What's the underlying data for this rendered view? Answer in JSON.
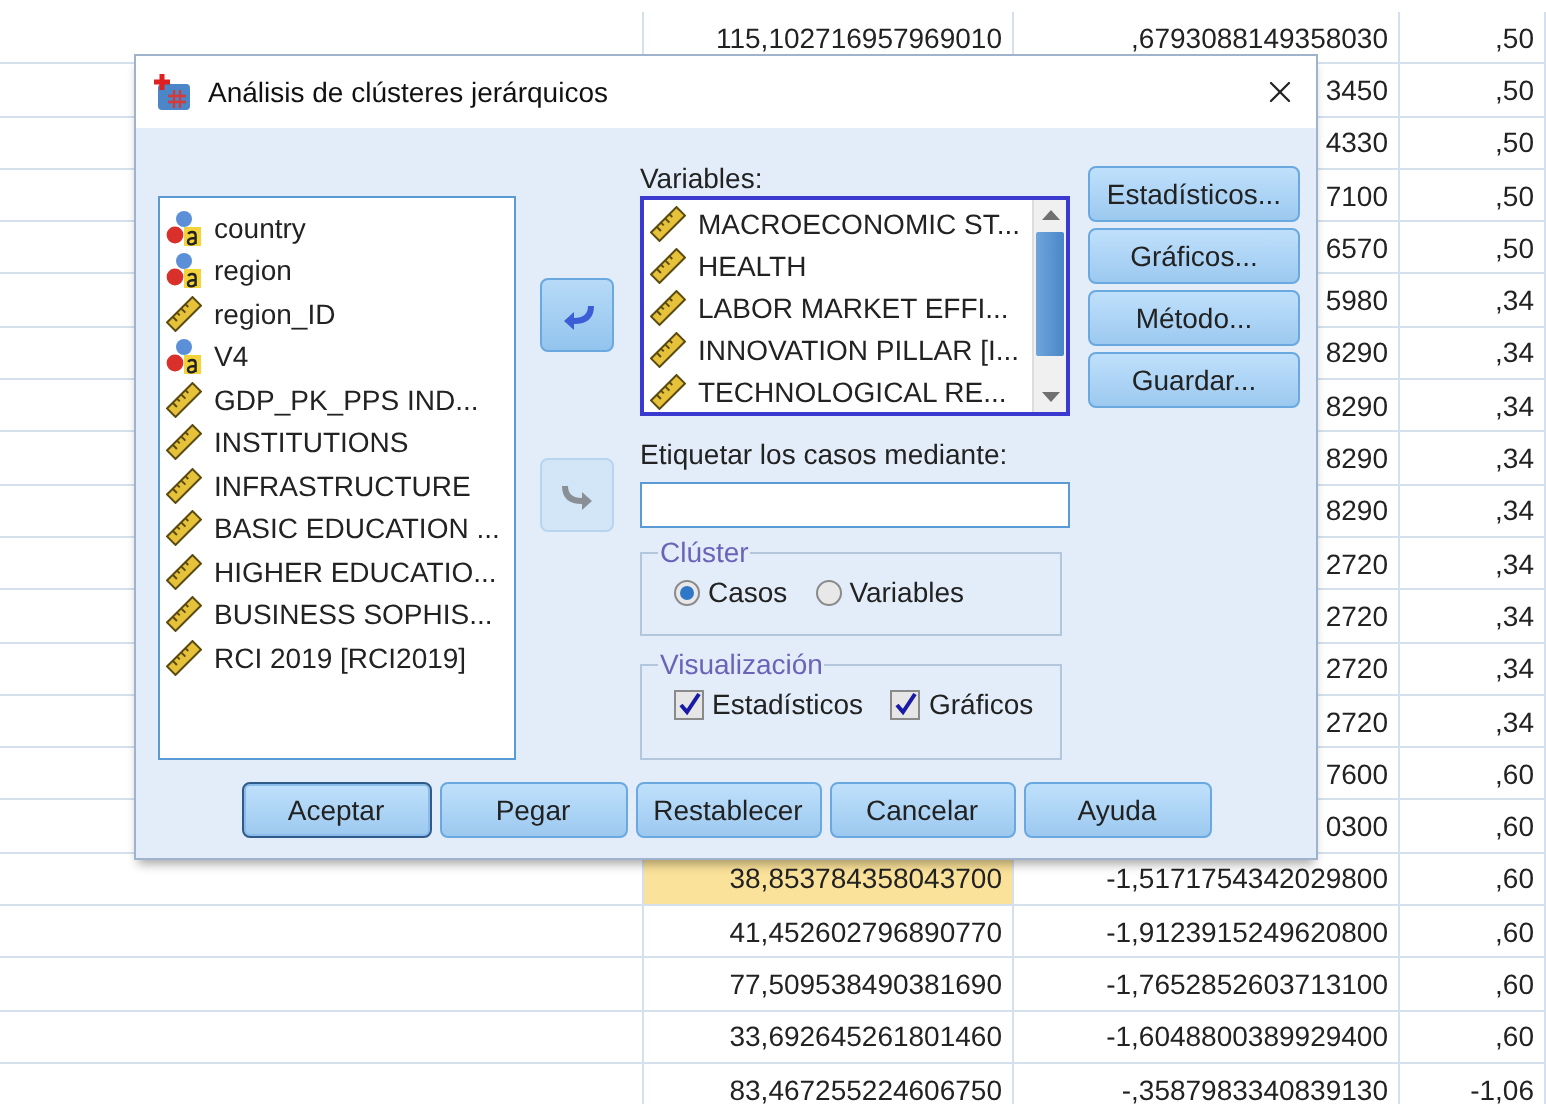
{
  "sheet": {
    "rows": [
      {
        "column_2": "115,102716957969010",
        "column_3": ",6793088149358030",
        "column_4": ",50",
        "selected": false
      },
      {
        "column_3": "3450",
        "column_4": ",50"
      },
      {
        "column_3": "4330",
        "column_4": ",50"
      },
      {
        "column_3": "7100",
        "column_4": ",50"
      },
      {
        "column_3": "6570",
        "column_4": ",50"
      },
      {
        "column_3": "5980",
        "column_4": ",34"
      },
      {
        "column_3": "8290",
        "column_4": ",34"
      },
      {
        "column_3": "8290",
        "column_4": ",34"
      },
      {
        "column_3": "8290",
        "column_4": ",34"
      },
      {
        "column_3": "8290",
        "column_4": ",34"
      },
      {
        "column_3": "2720",
        "column_4": ",34"
      },
      {
        "column_3": "2720",
        "column_4": ",34"
      },
      {
        "column_3": "2720",
        "column_4": ",34"
      },
      {
        "column_3": "2720",
        "column_4": ",34"
      },
      {
        "column_3": "7600",
        "column_4": ",60"
      },
      {
        "column_3": "0300",
        "column_4": ",60"
      },
      {
        "column_2": "38,853784358043700",
        "column_3": "-1,5171754342029800",
        "column_4": ",60",
        "selected": true
      },
      {
        "column_2": "41,452602796890770",
        "column_3": "-1,9123915249620800",
        "column_4": ",60",
        "selected": false
      },
      {
        "column_2": "77,509538490381690",
        "column_3": "-1,7652852603713100",
        "column_4": ",60",
        "selected": false
      },
      {
        "column_2": "33,692645261801460",
        "column_3": "-1,6048800389929400",
        "column_4": ",60",
        "selected": false
      },
      {
        "column_2": "83,467255224606750",
        "column_3": "-,3587983340839130",
        "column_4": "-1,06",
        "selected": false
      }
    ]
  },
  "dialog": {
    "title": "Análisis de clústeres jerárquicos",
    "source_list": [
      {
        "label": "country",
        "kind": "nominal"
      },
      {
        "label": "region",
        "kind": "nominal"
      },
      {
        "label": "region_ID",
        "kind": "scale"
      },
      {
        "label": "V4",
        "kind": "nominal"
      },
      {
        "label": "GDP_PK_PPS IND...",
        "kind": "scale"
      },
      {
        "label": "INSTITUTIONS",
        "kind": "scale"
      },
      {
        "label": "INFRASTRUCTURE",
        "kind": "scale"
      },
      {
        "label": "BASIC EDUCATION ...",
        "kind": "scale"
      },
      {
        "label": "HIGHER EDUCATIO...",
        "kind": "scale"
      },
      {
        "label": "BUSINESS SOPHIS...",
        "kind": "scale"
      },
      {
        "label": "RCI 2019 [RCI2019]",
        "kind": "scale"
      }
    ],
    "move_buttons": [
      {
        "kind": "left",
        "disabled": false
      },
      {
        "kind": "right",
        "disabled": true
      }
    ],
    "variables": {
      "label": "Variables:",
      "items": [
        {
          "label": "MACROECONOMIC ST...",
          "kind": "scale"
        },
        {
          "label": "HEALTH",
          "kind": "scale"
        },
        {
          "label": "LABOR MARKET EFFI...",
          "kind": "scale"
        },
        {
          "label": "INNOVATION PILLAR [I...",
          "kind": "scale"
        },
        {
          "label": "TECHNOLOGICAL RE...",
          "kind": "scale"
        }
      ]
    },
    "label_cases": {
      "label": "Etiquetar los casos mediante:"
    },
    "cluster": {
      "title": "Clúster",
      "options": [
        {
          "label": "Casos",
          "selected": true
        },
        {
          "label": "Variables",
          "selected": false
        }
      ]
    },
    "display": {
      "title": "Visualización",
      "options": [
        {
          "label": "Estadísticos",
          "checked": true
        },
        {
          "label": "Gráficos",
          "checked": true
        }
      ]
    },
    "side_buttons": [
      "Estadísticos...",
      "Gráficos...",
      "Método...",
      "Guardar..."
    ],
    "buttons": [
      {
        "label": "Aceptar",
        "default": true
      },
      {
        "label": "Pegar",
        "default": false
      },
      {
        "label": "Restablecer",
        "default": false
      },
      {
        "label": "Cancelar",
        "default": false
      },
      {
        "label": "Ayuda",
        "default": false
      }
    ]
  }
}
